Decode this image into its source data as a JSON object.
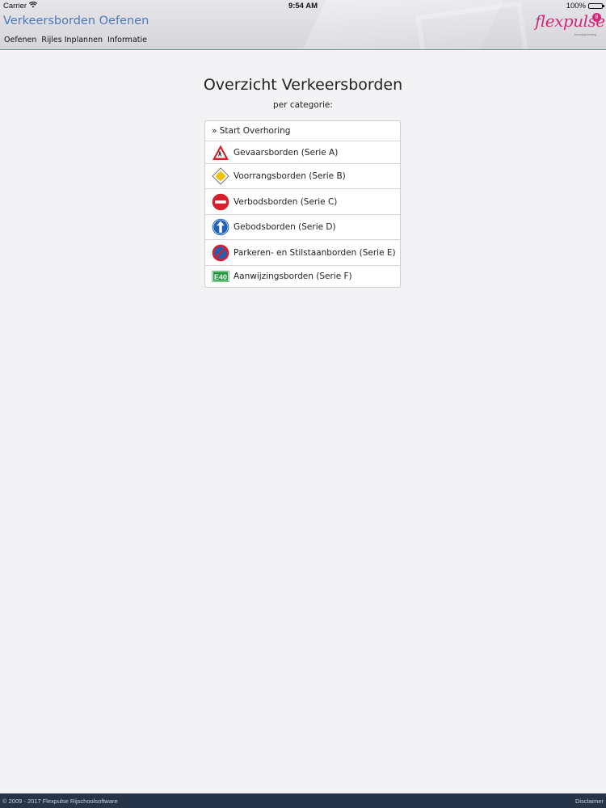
{
  "status_bar": {
    "carrier": "Carrier",
    "time": "9:54 AM",
    "battery": "100%"
  },
  "header": {
    "title": "Verkeersborden Oefenen",
    "nav": [
      "Oefenen",
      "Rijles Inplannen",
      "Informatie"
    ],
    "logo": {
      "word": "flexpulse",
      "badge": "8",
      "sub": "Autorijopleiding",
      "brand_color": "#d2297a"
    }
  },
  "main": {
    "title": "Overzicht Verkeersborden",
    "subtitle": "per categorie:",
    "start_label": "» Start Overhoring",
    "categories": [
      {
        "label": "Gevaarsborden (Serie A)",
        "icon": "warning-triangle-icon"
      },
      {
        "label": "Voorrangsborden (Serie B)",
        "icon": "priority-diamond-icon"
      },
      {
        "label": "Verbodsborden (Serie C)",
        "icon": "no-entry-icon"
      },
      {
        "label": "Gebodsborden (Serie D)",
        "icon": "mandatory-arrow-icon"
      },
      {
        "label": "Parkeren- en Stilstaanborden (Serie E)",
        "icon": "no-parking-icon"
      },
      {
        "label": "Aanwijzingsborden (Serie F)",
        "icon": "route-sign-icon"
      }
    ],
    "route_sign_text": "E40"
  },
  "footer": {
    "copyright": "© 2009 - 2017 Flexpulse Rijschoolsoftware",
    "disclaimer": "Disclaimer"
  },
  "colors": {
    "title_blue": "#4b78b8",
    "accent_pink": "#d85a86",
    "footer_bg": "#253448"
  }
}
